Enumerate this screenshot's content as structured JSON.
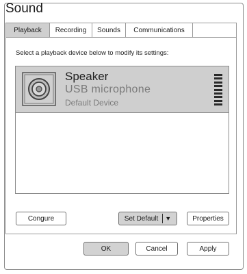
{
  "window": {
    "title": "Sound"
  },
  "tabs": [
    "Playback",
    "Recording",
    "Sounds",
    "Communications"
  ],
  "active_tab": "Playback",
  "instruction": "Select a playback device below to modify its settings:",
  "devices": [
    {
      "name": "Speaker",
      "description": "USB microphone",
      "status": "Default Device",
      "icon": "speaker-icon"
    }
  ],
  "buttons": {
    "configure": "Congure",
    "set_default": "Set Default",
    "set_default_caret": "▼",
    "properties": "Properties",
    "ok": "OK",
    "cancel": "Cancel",
    "apply": "Apply"
  }
}
